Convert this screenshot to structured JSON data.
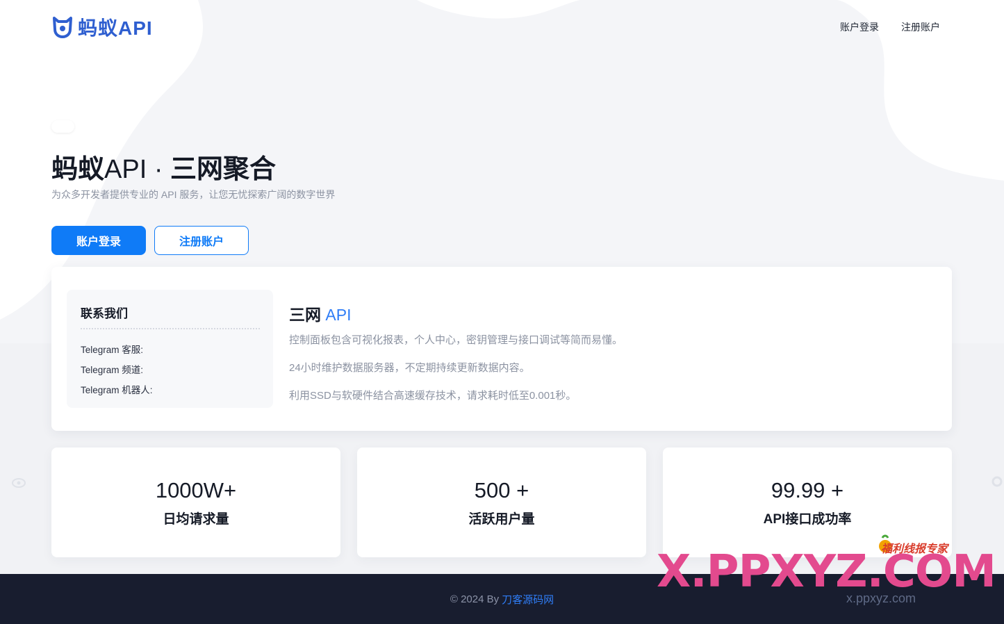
{
  "brand": {
    "logo_text": "蚂蚁API",
    "accent": "#0f7bf7"
  },
  "nav": {
    "login": "账户登录",
    "register": "注册账户"
  },
  "hero": {
    "title_bold": "蚂蚁",
    "title_light": "API · ",
    "title_bold2": "三网聚合",
    "subtitle": "为众多开发者提供专业的 API 服务，让您无忧探索广阔的数字世界",
    "login_button": "账户登录",
    "register_button": "注册账户"
  },
  "contact": {
    "title": "联系我们",
    "items": [
      "Telegram 客服:",
      "Telegram 频道:",
      "Telegram 机器人:"
    ]
  },
  "info": {
    "heading_main": "三网 ",
    "heading_accent": "API",
    "lines": [
      "控制面板包含可视化报表，个人中心，密钥管理与接口调试等简而易懂。",
      "24小时维护数据服务器，不定期持续更新数据内容。",
      "利用SSD与软硬件结合高速缓存技术，请求耗时低至0.001秒。"
    ]
  },
  "stats": [
    {
      "value": "1000W+",
      "label": "日均请求量"
    },
    {
      "value": "500 +",
      "label": "活跃用户量"
    },
    {
      "value": "99.99 +",
      "label": "API接口成功率"
    }
  ],
  "footer": {
    "prefix": "© 2024 By",
    "link": "刀客源码网"
  },
  "watermark": {
    "tag": "福利线报专家",
    "big": "X.PPXYZ.COM",
    "small": "x.ppxyz.com"
  }
}
